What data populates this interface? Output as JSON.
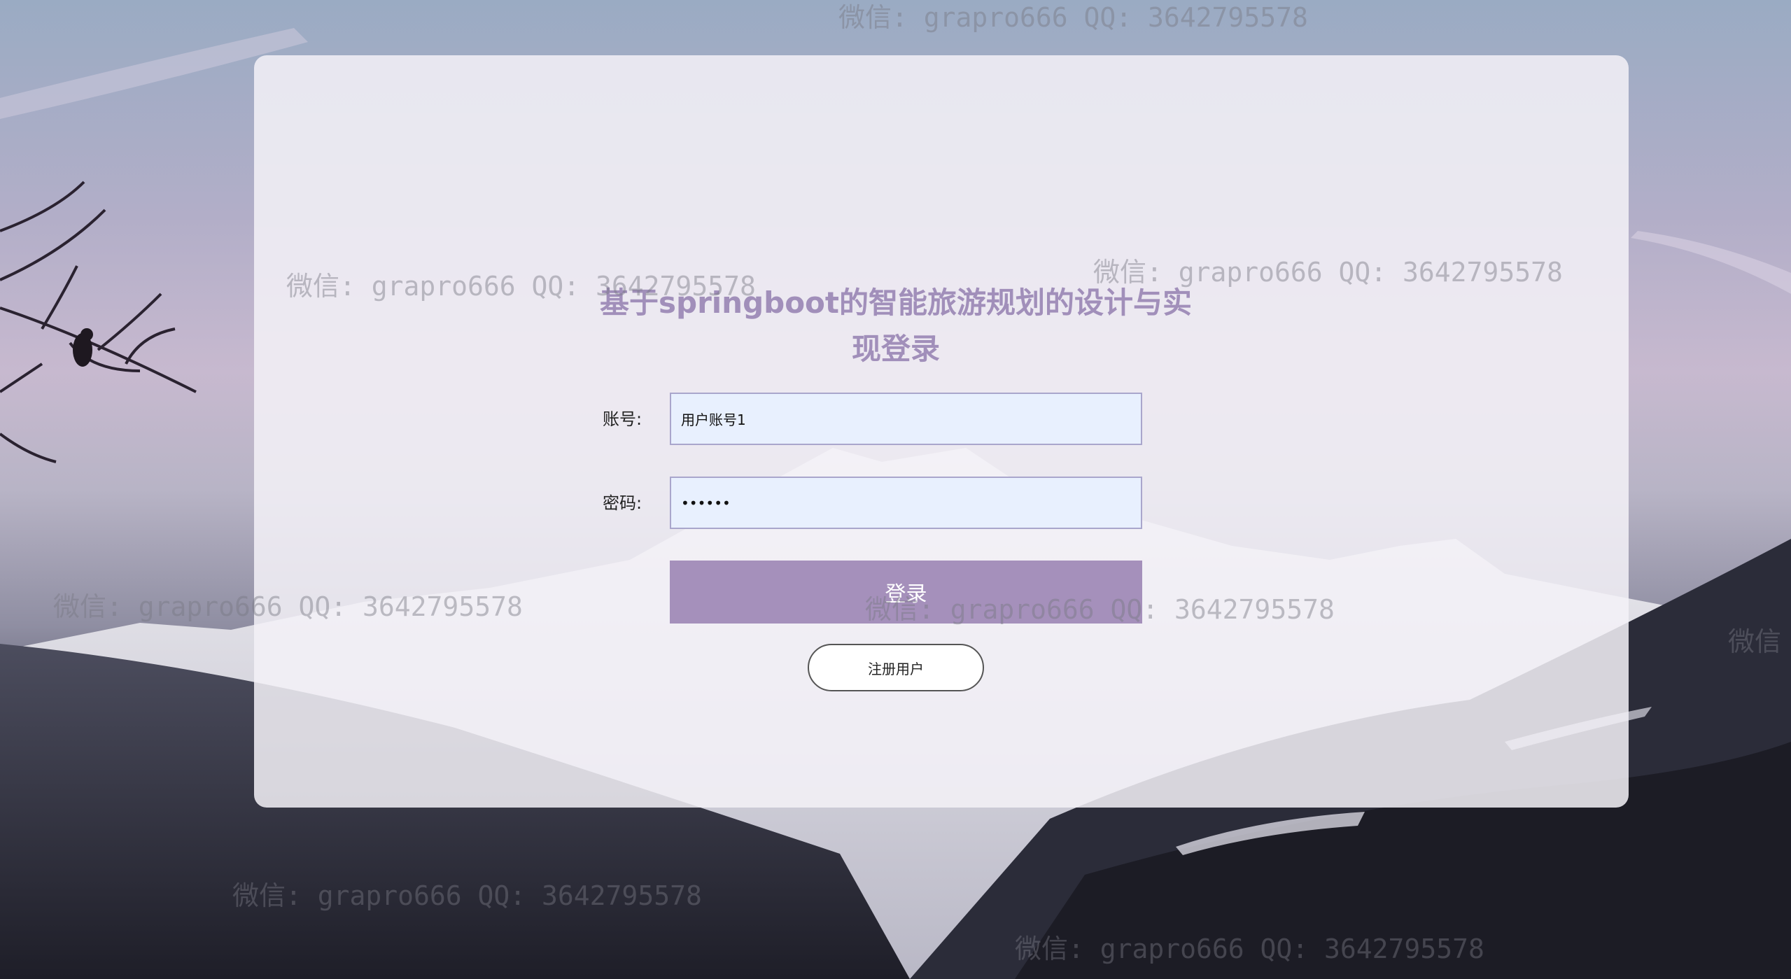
{
  "login": {
    "title": "基于springboot的智能旅游规划的设计与实现登录",
    "account_label": "账号:",
    "account_value": "用户账号1",
    "password_label": "密码:",
    "password_value": "123456",
    "login_button": "登录",
    "register_button": "注册用户"
  },
  "watermark": {
    "text": "微信: grapro666 QQ: 3642795578",
    "partial_text": "微信"
  },
  "colors": {
    "accent": "#a590bb",
    "title": "#a18fba",
    "input_bg": "#e8f0fe"
  }
}
